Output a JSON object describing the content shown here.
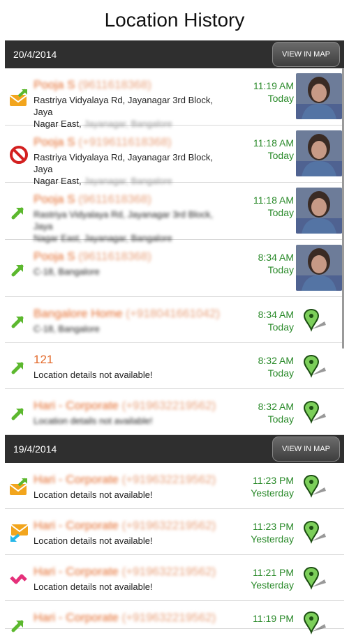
{
  "title": "Location History",
  "sections": [
    {
      "date": "20/4/2014",
      "map_button": "VIEW IN MAP",
      "rows": [
        {
          "name": "Pooja S",
          "number": "(9611618368)",
          "addr1": "Rastriya Vidyalaya Rd, Jayanagar 3rd Block, Jaya",
          "addr2a": "Nagar East,",
          "addr2b": "Jayanagar, Bangalore",
          "time": "11:19 AM",
          "day": "Today",
          "icon": "sms-outgoing-icon",
          "media": "contact-photo",
          "name_blur": true
        },
        {
          "name": "Pooja S",
          "number": "(+919611618368)",
          "addr1": "Rastriya Vidyalaya Rd, Jayanagar 3rd Block, Jaya",
          "addr2a": "Nagar East,",
          "addr2b": "Jayanagar, Bangalore",
          "time": "11:18 AM",
          "day": "Today",
          "icon": "blocked-call-icon",
          "media": "contact-photo",
          "name_blur": true
        },
        {
          "name": "Pooja S",
          "number": "(9611618368)",
          "addr1": "Rastriya Vidyalaya Rd, Jayanagar 3rd Block, Jaya",
          "addr2a": "Nagar East, Jayanagar, Bangalore",
          "addr2b": "",
          "time": "11:18 AM",
          "day": "Today",
          "icon": "outgoing-call-icon",
          "media": "contact-photo",
          "name_blur": true,
          "addr_blur": true
        },
        {
          "name": "Pooja S",
          "number": "(9611618368)",
          "addr1": "C-18, Bangalore",
          "addr2a": "",
          "addr2b": "",
          "time": "8:34 AM",
          "day": "Today",
          "icon": "outgoing-call-icon",
          "media": "contact-photo",
          "name_blur": true,
          "addr_blur": true
        },
        {
          "name": "Bangalore Home",
          "number": "(+918041661042)",
          "addr1": "C-18, Bangalore",
          "addr2a": "",
          "addr2b": "",
          "time": "8:34 AM",
          "day": "Today",
          "icon": "outgoing-call-icon",
          "media": "map-pin",
          "name_blur": true,
          "addr_blur": true
        },
        {
          "name": "121",
          "number": "",
          "addr1": "Location details not available!",
          "addr2a": "",
          "addr2b": "",
          "time": "8:32 AM",
          "day": "Today",
          "icon": "outgoing-call-icon",
          "media": "map-pin",
          "name_blur": false
        },
        {
          "name": "Hari - Corporate",
          "number": "(+919632219562)",
          "addr1": "Location details not available!",
          "addr2a": "",
          "addr2b": "",
          "time": "8:32 AM",
          "day": "Today",
          "icon": "outgoing-call-icon",
          "media": "map-pin",
          "name_blur": true,
          "addr_blur": true
        }
      ]
    },
    {
      "date": "19/4/2014",
      "map_button": "VIEW IN MAP",
      "rows": [
        {
          "name": "Hari - Corporate",
          "number": "(+919632219562)",
          "addr1": "Location details not available!",
          "addr2a": "",
          "addr2b": "",
          "time": "11:23 PM",
          "day": "Yesterday",
          "icon": "sms-outgoing-icon",
          "media": "map-pin",
          "name_blur": true
        },
        {
          "name": "Hari - Corporate",
          "number": "(+919632219562)",
          "addr1": "Location details not available!",
          "addr2a": "",
          "addr2b": "",
          "time": "11:23 PM",
          "day": "Yesterday",
          "icon": "sms-incoming-icon",
          "media": "map-pin",
          "name_blur": true
        },
        {
          "name": "Hari - Corporate",
          "number": "(+919632219562)",
          "addr1": "Location details not available!",
          "addr2a": "",
          "addr2b": "",
          "time": "11:21 PM",
          "day": "Yesterday",
          "icon": "missed-call-icon",
          "media": "map-pin",
          "name_blur": true
        },
        {
          "name": "Hari - Corporate",
          "number": "(+919632219562)",
          "addr1": "",
          "addr2a": "",
          "addr2b": "",
          "time": "11:19 PM",
          "day": "",
          "icon": "outgoing-call-icon",
          "media": "map-pin",
          "name_blur": true
        }
      ]
    }
  ]
}
